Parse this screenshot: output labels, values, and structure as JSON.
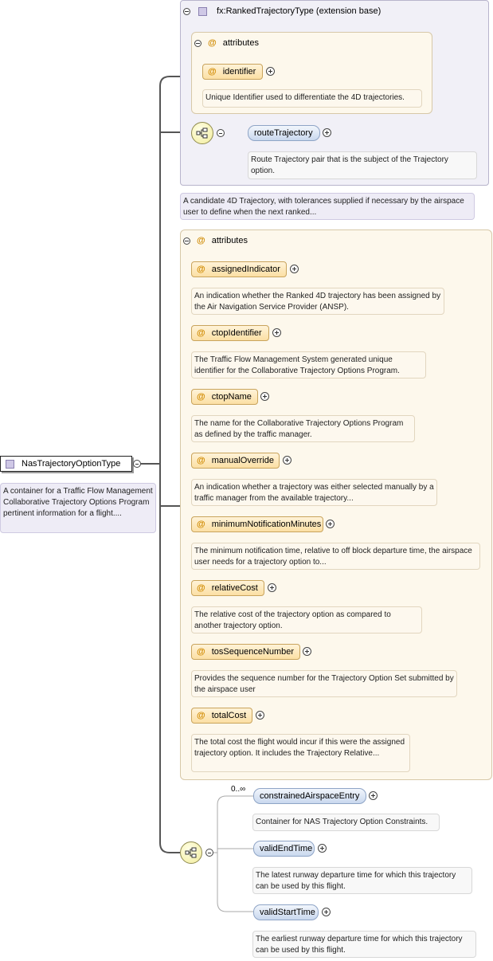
{
  "root": {
    "name": "NasTrajectoryOptionType",
    "doc": "A container for a Traffic Flow Management Collaborative Trajectory Options Program pertinent information for a flight...."
  },
  "extension": {
    "title": "fx:RankedTrajectoryType (extension base)",
    "attributes_label": "attributes",
    "identifier": {
      "name": "identifier",
      "doc": "Unique Identifier used to differentiate the 4D trajectories."
    },
    "routeTrajectory": {
      "name": "routeTrajectory",
      "doc": "Route Trajectory pair that is the subject of the Trajectory option."
    }
  },
  "extension_doc": "A candidate 4D Trajectory, with tolerances supplied if necessary by the airspace user to define when the next ranked...",
  "attributes": {
    "label": "attributes",
    "items": [
      {
        "name": "assignedIndicator",
        "doc": "An indication whether the Ranked 4D trajectory has been assigned by the Air Navigation Service Provider (ANSP)."
      },
      {
        "name": "ctopIdentifier",
        "doc": "The Traffic Flow Management System generated unique identifier for the Collaborative Trajectory Options Program."
      },
      {
        "name": "ctopName",
        "doc": "The name for the Collaborative Trajectory Options Program as defined by the traffic manager."
      },
      {
        "name": "manualOverride",
        "doc": "An indication whether a trajectory was either selected manually by a traffic manager from the available trajectory..."
      },
      {
        "name": "minimumNotificationMinutes",
        "doc": "The minimum notification time, relative to off block departure time, the airspace user needs for a trajectory option to..."
      },
      {
        "name": "relativeCost",
        "doc": "The relative cost of the trajectory option as compared to another trajectory option."
      },
      {
        "name": "tosSequenceNumber",
        "doc": "Provides the sequence number for the Trajectory Option Set submitted by the airspace user"
      },
      {
        "name": "totalCost",
        "doc": "The total cost the flight would incur if this were the assigned trajectory option. It includes the Trajectory Relative..."
      }
    ]
  },
  "sequence": {
    "cardinality": "0..∞",
    "items": [
      {
        "name": "constrainedAirspaceEntry",
        "doc": "Container for NAS Trajectory Option Constraints."
      },
      {
        "name": "validEndTime",
        "doc": "The latest runway departure time for which this trajectory can be used by this flight."
      },
      {
        "name": "validStartTime",
        "doc": "The earliest runway departure time for which this trajectory can be used by this flight."
      }
    ]
  }
}
